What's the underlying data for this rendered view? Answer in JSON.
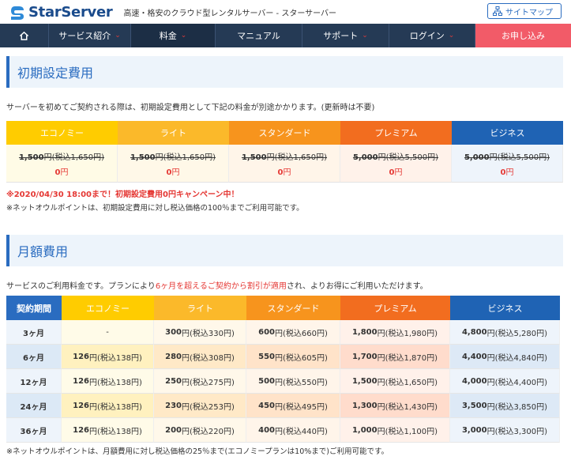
{
  "header": {
    "logo_text": "StarServer",
    "tagline": "高速・格安のクラウド型レンタルサーバー - スターサーバー",
    "sitemap_label": "サイトマップ"
  },
  "nav": {
    "items": [
      {
        "label": "サービス紹介"
      },
      {
        "label": "料金"
      },
      {
        "label": "マニュアル"
      },
      {
        "label": "サポート"
      },
      {
        "label": "ログイン"
      },
      {
        "label": "お申し込み"
      }
    ]
  },
  "initial": {
    "title": "初期設定費用",
    "desc": "サーバーを初めてご契約される際は、初期設定費用として下記の料金が別途かかります。(更新時は不要)",
    "plans": [
      {
        "name": "エコノミー",
        "old_price": "1,500",
        "old_unit": "円(税込1,650円)",
        "new_price": "0",
        "new_unit": "円"
      },
      {
        "name": "ライト",
        "old_price": "1,500",
        "old_unit": "円(税込1,650円)",
        "new_price": "0",
        "new_unit": "円"
      },
      {
        "name": "スタンダード",
        "old_price": "1,500",
        "old_unit": "円(税込1,650円)",
        "new_price": "0",
        "new_unit": "円"
      },
      {
        "name": "プレミアム",
        "old_price": "5,000",
        "old_unit": "円(税込5,500円)",
        "new_price": "0",
        "new_unit": "円"
      },
      {
        "name": "ビジネス",
        "old_price": "5,000",
        "old_unit": "円(税込5,500円)",
        "new_price": "0",
        "new_unit": "円"
      }
    ],
    "campaign": "※2020/04/30 18:00まで！初期設定費用0円キャンペーン中！",
    "note": "※ネットオウルポイントは、初期設定費用に対し税込価格の100％までご利用可能です。"
  },
  "colors": {
    "economy": "#ffcc00",
    "light": "#fbb92a",
    "standard": "#f7941d",
    "premium": "#f26d1f",
    "business": "#1f63b4",
    "period": "#2a6cc0",
    "accent_red": "#e53935",
    "nav_bg": "#253a55",
    "cta": "#f25b68"
  },
  "monthly": {
    "title": "月額費用",
    "desc_before": "サービスのご利用料金です。プランにより",
    "desc_highlight": "6ヶ月を超えるご契約から割引が適用",
    "desc_after": "され、よりお得にご利用いただけます。",
    "period_header": "契約期間",
    "plan_headers": [
      "エコノミー",
      "ライト",
      "スタンダード",
      "プレミアム",
      "ビジネス"
    ],
    "rows": [
      {
        "period": "3ヶ月",
        "cells": [
          {
            "price": "-",
            "unit": ""
          },
          {
            "price": "300",
            "unit": "円(税込330円)"
          },
          {
            "price": "600",
            "unit": "円(税込660円)"
          },
          {
            "price": "1,800",
            "unit": "円(税込1,980円)"
          },
          {
            "price": "4,800",
            "unit": "円(税込5,280円)"
          }
        ]
      },
      {
        "period": "6ヶ月",
        "cells": [
          {
            "price": "126",
            "unit": "円(税込138円)"
          },
          {
            "price": "280",
            "unit": "円(税込308円)"
          },
          {
            "price": "550",
            "unit": "円(税込605円)"
          },
          {
            "price": "1,700",
            "unit": "円(税込1,870円)"
          },
          {
            "price": "4,400",
            "unit": "円(税込4,840円)"
          }
        ]
      },
      {
        "period": "12ヶ月",
        "cells": [
          {
            "price": "126",
            "unit": "円(税込138円)"
          },
          {
            "price": "250",
            "unit": "円(税込275円)"
          },
          {
            "price": "500",
            "unit": "円(税込550円)"
          },
          {
            "price": "1,500",
            "unit": "円(税込1,650円)"
          },
          {
            "price": "4,000",
            "unit": "円(税込4,400円)"
          }
        ]
      },
      {
        "period": "24ヶ月",
        "cells": [
          {
            "price": "126",
            "unit": "円(税込138円)"
          },
          {
            "price": "230",
            "unit": "円(税込253円)"
          },
          {
            "price": "450",
            "unit": "円(税込495円)"
          },
          {
            "price": "1,300",
            "unit": "円(税込1,430円)"
          },
          {
            "price": "3,500",
            "unit": "円(税込3,850円)"
          }
        ]
      },
      {
        "period": "36ヶ月",
        "cells": [
          {
            "price": "126",
            "unit": "円(税込138円)"
          },
          {
            "price": "200",
            "unit": "円(税込220円)"
          },
          {
            "price": "400",
            "unit": "円(税込440円)"
          },
          {
            "price": "1,000",
            "unit": "円(税込1,100円)"
          },
          {
            "price": "3,000",
            "unit": "円(税込3,300円)"
          }
        ]
      }
    ],
    "note": "※ネットオウルポイントは、月額費用に対し税込価格の25％まで(エコノミープランは10%まで)ご利用可能です。"
  }
}
